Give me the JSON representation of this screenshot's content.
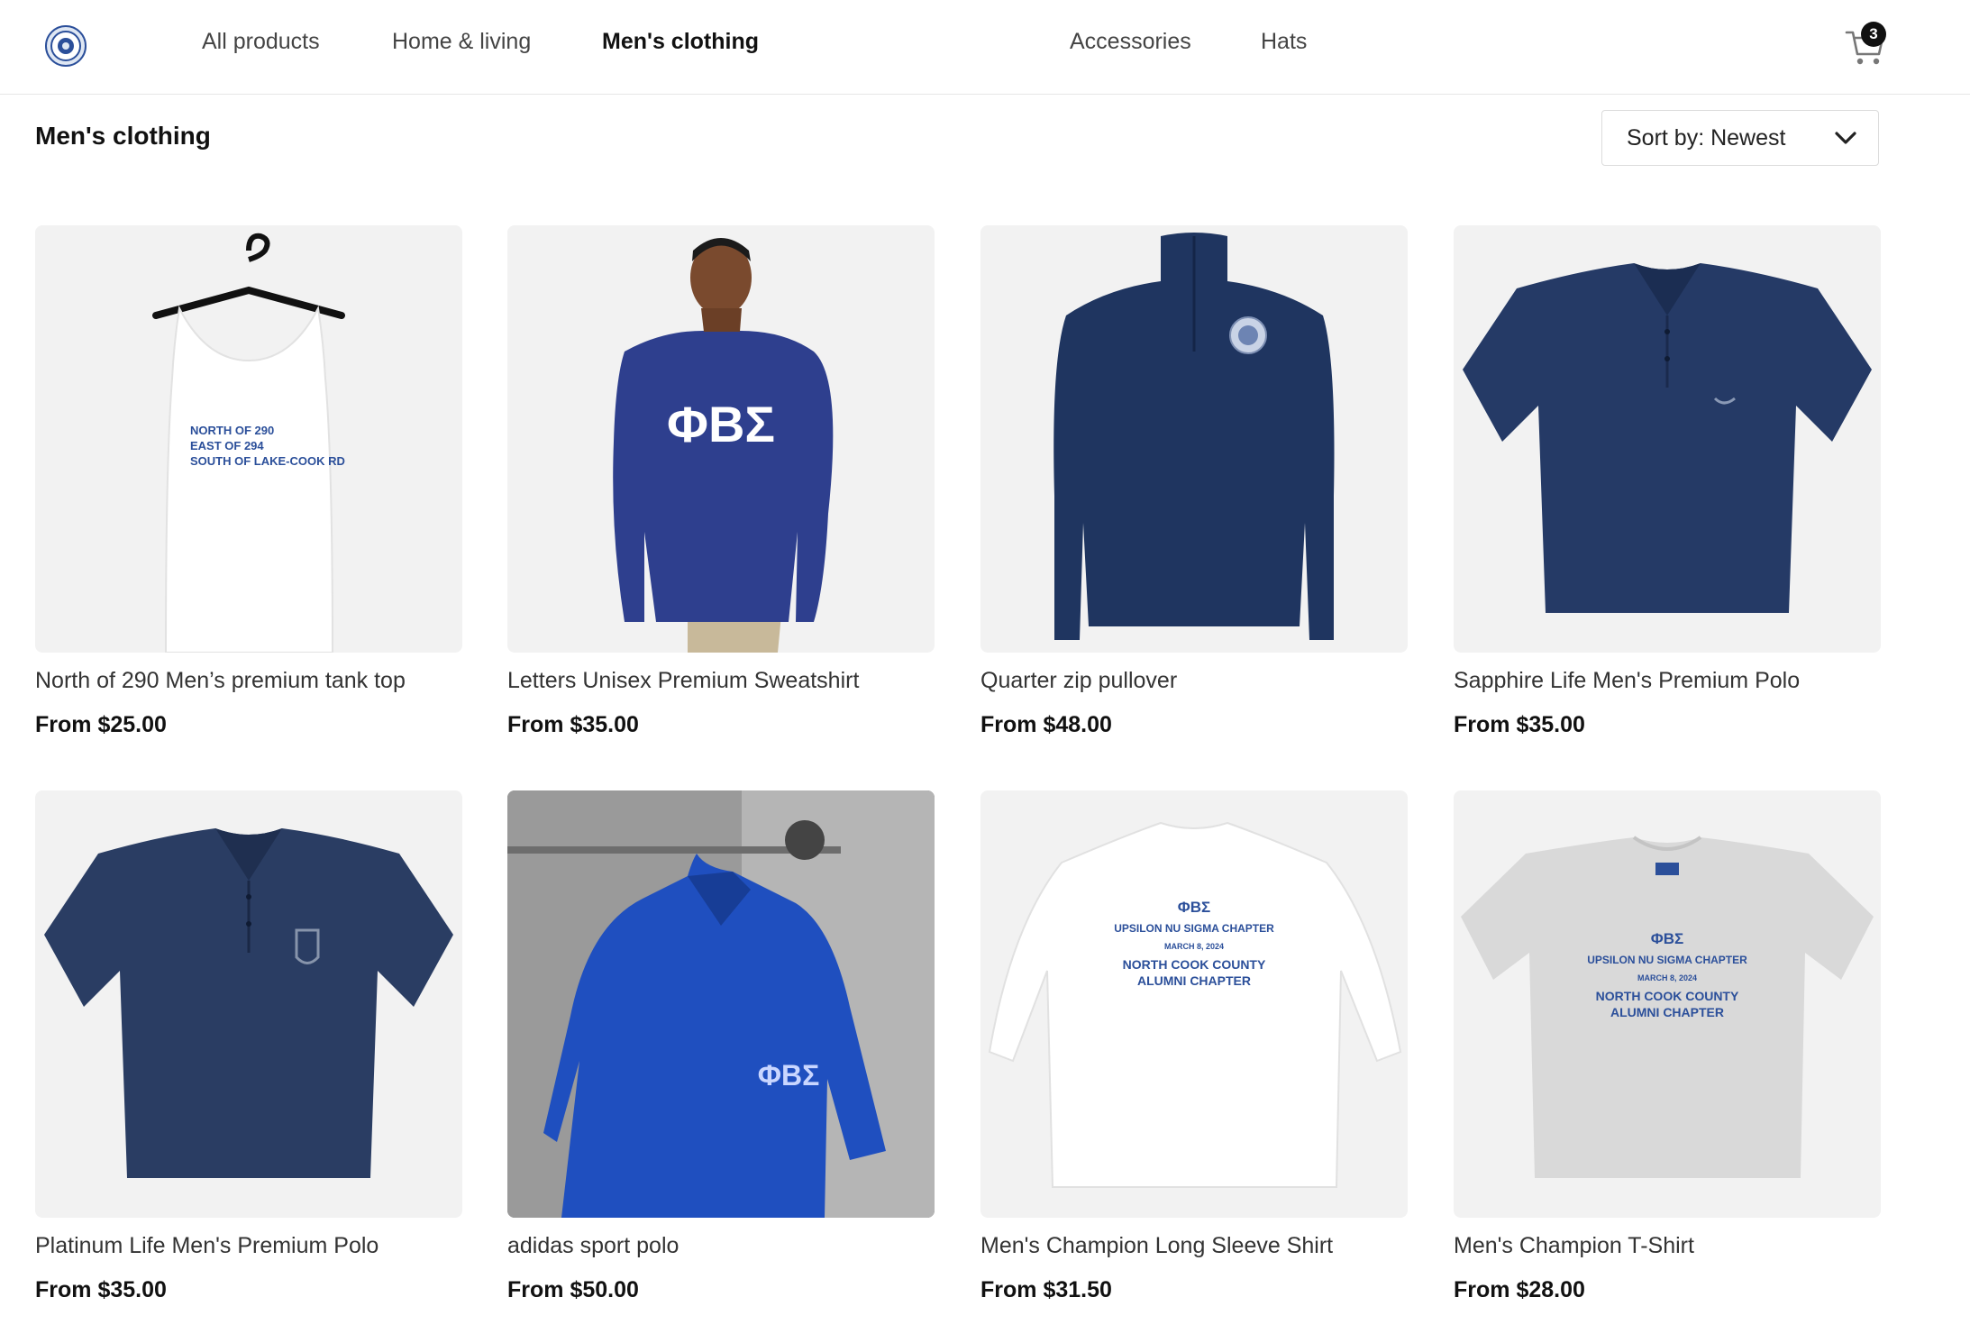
{
  "nav": {
    "items": [
      {
        "label": "All products"
      },
      {
        "label": "Home & living"
      },
      {
        "label": "Men's clothing",
        "active": true
      },
      {
        "label": "Accessories"
      },
      {
        "label": "Hats"
      }
    ],
    "cart_count": "3",
    "logo_icon": "chapter-seal-logo",
    "cart_icon": "shopping-cart-icon"
  },
  "page": {
    "title": "Men's clothing",
    "sort_label": "Sort by: Newest",
    "sort_icon": "chevron-down-icon"
  },
  "products": [
    {
      "title": "North of 290 Men’s premium tank top",
      "price": "From $25.00",
      "print_lines": [
        "NORTH OF 290",
        "EAST OF 294",
        "SOUTH OF LAKE-COOK RD"
      ]
    },
    {
      "title": "Letters Unisex Premium Sweatshirt",
      "price": "From $35.00",
      "print": "ΦΒΣ"
    },
    {
      "title": "Quarter zip pullover",
      "price": "From $48.00"
    },
    {
      "title": "Sapphire Life Men's Premium Polo",
      "price": "From $35.00"
    },
    {
      "title": "Platinum Life Men's Premium Polo",
      "price": "From $35.00"
    },
    {
      "title": "adidas sport polo",
      "price": "From $50.00",
      "print": "ΦΒΣ"
    },
    {
      "title": "Men's Champion Long Sleeve Shirt",
      "price": "From $31.50",
      "print_lines": [
        "ΦΒΣ",
        "UPSILON NU SIGMA CHAPTER",
        "MARCH 8, 2024",
        "NORTH COOK COUNTY",
        "ALUMNI CHAPTER"
      ]
    },
    {
      "title": "Men's Champion T-Shirt",
      "price": "From $28.00",
      "print_lines": [
        "ΦΒΣ",
        "UPSILON NU SIGMA CHAPTER",
        "MARCH 8, 2024",
        "NORTH COOK COUNTY",
        "ALUMNI CHAPTER"
      ]
    }
  ],
  "colors": {
    "navy": "#1f3560",
    "royal": "#2a3f8f",
    "adidas_blue": "#1f4fbf",
    "print_blue": "#2b4f9a",
    "card_bg": "#f2f2f2"
  }
}
